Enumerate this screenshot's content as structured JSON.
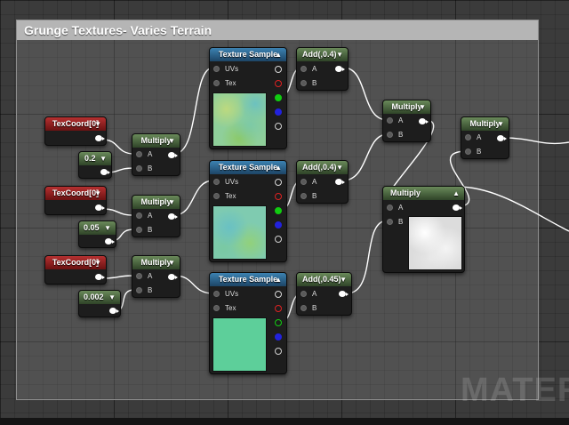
{
  "comment": {
    "title": "Grunge Textures- Varies Terrain"
  },
  "watermark": "MATER",
  "nodes": {
    "texcoord": [
      {
        "label": "TexCoord[0]"
      },
      {
        "label": "TexCoord[0]"
      },
      {
        "label": "TexCoord[0]"
      }
    ],
    "constants": [
      {
        "label": "0.2"
      },
      {
        "label": "0.05"
      },
      {
        "label": "0.002"
      }
    ],
    "multiply_uv": [
      {
        "label": "Multiply",
        "pin_a": "A",
        "pin_b": "B"
      },
      {
        "label": "Multiply",
        "pin_a": "A",
        "pin_b": "B"
      },
      {
        "label": "Multiply",
        "pin_a": "A",
        "pin_b": "B"
      }
    ],
    "texture_samples": [
      {
        "label": "Texture Sample",
        "pin_uvs": "UVs",
        "pin_tex": "Tex"
      },
      {
        "label": "Texture Sample",
        "pin_uvs": "UVs",
        "pin_tex": "Tex"
      },
      {
        "label": "Texture Sample",
        "pin_uvs": "UVs",
        "pin_tex": "Tex"
      }
    ],
    "adds": [
      {
        "label": "Add(,0.4)",
        "pin_a": "A",
        "pin_b": "B"
      },
      {
        "label": "Add(,0.4)",
        "pin_a": "A",
        "pin_b": "B"
      },
      {
        "label": "Add(,0.45)",
        "pin_a": "A",
        "pin_b": "B"
      }
    ],
    "multiply_mid": {
      "label": "Multiply",
      "pin_a": "A",
      "pin_b": "B"
    },
    "multiply_tex": {
      "label": "Multiply",
      "pin_a": "A",
      "pin_b": "B"
    },
    "multiply_right": {
      "label": "Multiply",
      "pin_a": "A",
      "pin_b": "B"
    }
  },
  "colors": {
    "texcoord_header": "#b63030",
    "constant_header": "#6a8a5a",
    "texture_header": "#3c82b2",
    "wire": "#ffffff"
  },
  "icons": {
    "collapse": "caret-down-icon",
    "collapse_up": "caret-up-icon"
  }
}
